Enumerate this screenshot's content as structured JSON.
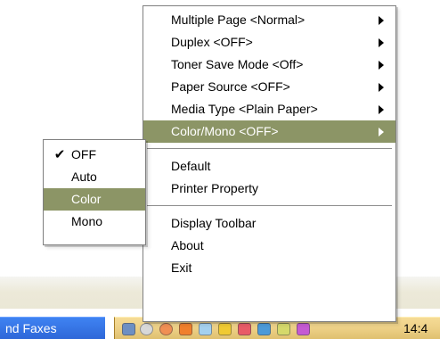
{
  "menu": {
    "items": [
      {
        "label": "Multiple Page <Normal>",
        "has_submenu": true
      },
      {
        "label": "Duplex <OFF>",
        "has_submenu": true
      },
      {
        "label": "Toner Save Mode <Off>",
        "has_submenu": true
      },
      {
        "label": "Paper Source <OFF>",
        "has_submenu": true
      },
      {
        "label": "Media Type <Plain Paper>",
        "has_submenu": true
      },
      {
        "label": "Color/Mono <OFF>",
        "has_submenu": true,
        "selected": true
      },
      {
        "label": "Default"
      },
      {
        "label": "Printer Property"
      },
      {
        "label": "Display Toolbar"
      },
      {
        "label": "About"
      },
      {
        "label": "Exit"
      }
    ]
  },
  "submenu": {
    "items": [
      {
        "label": "OFF",
        "checked": true
      },
      {
        "label": "Auto"
      },
      {
        "label": "Color",
        "selected": true
      },
      {
        "label": "Mono"
      }
    ]
  },
  "taskbar": {
    "button_label": "nd Faxes",
    "clock": "14:4",
    "tray_icons": [
      "printer-icon",
      "network-icon",
      "power-icon",
      "security-icon",
      "utility-icon",
      "tool-icon",
      "alert-icon",
      "display-icon",
      "volume-icon",
      "messenger-icon"
    ]
  },
  "colors": {
    "selection": "#8c9566",
    "menu_border": "#7f7f7f",
    "tray": "#eccf85",
    "taskbar_button": "#3f83f2"
  }
}
